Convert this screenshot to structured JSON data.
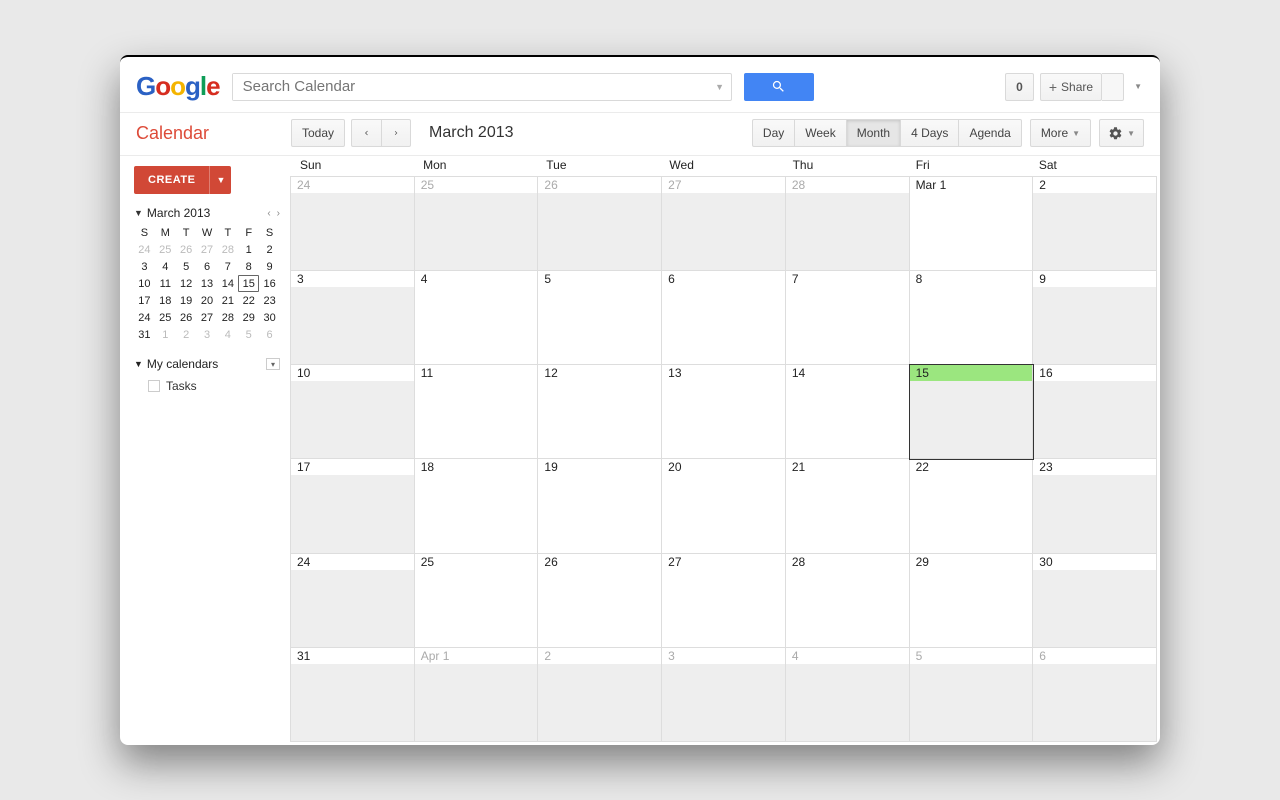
{
  "header": {
    "search_placeholder": "Search Calendar",
    "notif_count": "0",
    "share_label": "Share"
  },
  "toolbar": {
    "app_title": "Calendar",
    "today_label": "Today",
    "period_title": "March 2013",
    "views": [
      "Day",
      "Week",
      "Month",
      "4 Days",
      "Agenda"
    ],
    "active_view": "Month",
    "more_label": "More"
  },
  "sidebar": {
    "create_label": "CREATE",
    "mini_month_label": "March 2013",
    "dow": [
      "S",
      "M",
      "T",
      "W",
      "T",
      "F",
      "S"
    ],
    "mini_grid": [
      [
        {
          "d": "24",
          "o": true
        },
        {
          "d": "25",
          "o": true
        },
        {
          "d": "26",
          "o": true
        },
        {
          "d": "27",
          "o": true
        },
        {
          "d": "28",
          "o": true
        },
        {
          "d": "1"
        },
        {
          "d": "2"
        }
      ],
      [
        {
          "d": "3"
        },
        {
          "d": "4"
        },
        {
          "d": "5"
        },
        {
          "d": "6"
        },
        {
          "d": "7"
        },
        {
          "d": "8"
        },
        {
          "d": "9"
        }
      ],
      [
        {
          "d": "10"
        },
        {
          "d": "11"
        },
        {
          "d": "12"
        },
        {
          "d": "13"
        },
        {
          "d": "14"
        },
        {
          "d": "15",
          "today": true
        },
        {
          "d": "16"
        }
      ],
      [
        {
          "d": "17"
        },
        {
          "d": "18"
        },
        {
          "d": "19"
        },
        {
          "d": "20"
        },
        {
          "d": "21"
        },
        {
          "d": "22"
        },
        {
          "d": "23"
        }
      ],
      [
        {
          "d": "24"
        },
        {
          "d": "25"
        },
        {
          "d": "26"
        },
        {
          "d": "27"
        },
        {
          "d": "28"
        },
        {
          "d": "29"
        },
        {
          "d": "30"
        }
      ],
      [
        {
          "d": "31"
        },
        {
          "d": "1",
          "o": true
        },
        {
          "d": "2",
          "o": true
        },
        {
          "d": "3",
          "o": true
        },
        {
          "d": "4",
          "o": true
        },
        {
          "d": "5",
          "o": true
        },
        {
          "d": "6",
          "o": true
        }
      ]
    ],
    "my_calendars_label": "My calendars",
    "tasks_label": "Tasks"
  },
  "month": {
    "dow": [
      "Sun",
      "Mon",
      "Tue",
      "Wed",
      "Thu",
      "Fri",
      "Sat"
    ],
    "shade_cols": [
      0,
      6
    ],
    "cells": [
      {
        "label": "24",
        "out": true,
        "shade": true
      },
      {
        "label": "25",
        "out": true
      },
      {
        "label": "26",
        "out": true
      },
      {
        "label": "27",
        "out": true
      },
      {
        "label": "28",
        "out": true
      },
      {
        "label": "Mar 1"
      },
      {
        "label": "2",
        "shade": true
      },
      {
        "label": "3",
        "shade": true
      },
      {
        "label": "4"
      },
      {
        "label": "5"
      },
      {
        "label": "6"
      },
      {
        "label": "7"
      },
      {
        "label": "8"
      },
      {
        "label": "9",
        "shade": true
      },
      {
        "label": "10",
        "shade": true
      },
      {
        "label": "11"
      },
      {
        "label": "12"
      },
      {
        "label": "13"
      },
      {
        "label": "14"
      },
      {
        "label": "15",
        "today": true,
        "shade": true
      },
      {
        "label": "16",
        "shade": true
      },
      {
        "label": "17",
        "shade": true
      },
      {
        "label": "18"
      },
      {
        "label": "19"
      },
      {
        "label": "20"
      },
      {
        "label": "21"
      },
      {
        "label": "22"
      },
      {
        "label": "23",
        "shade": true
      },
      {
        "label": "24",
        "shade": true
      },
      {
        "label": "25"
      },
      {
        "label": "26"
      },
      {
        "label": "27"
      },
      {
        "label": "28"
      },
      {
        "label": "29"
      },
      {
        "label": "30",
        "shade": true
      },
      {
        "label": "31",
        "shade": true
      },
      {
        "label": "Apr 1",
        "out": true
      },
      {
        "label": "2",
        "out": true
      },
      {
        "label": "3",
        "out": true
      },
      {
        "label": "4",
        "out": true
      },
      {
        "label": "5",
        "out": true
      },
      {
        "label": "6",
        "out": true,
        "shade": true
      }
    ]
  }
}
